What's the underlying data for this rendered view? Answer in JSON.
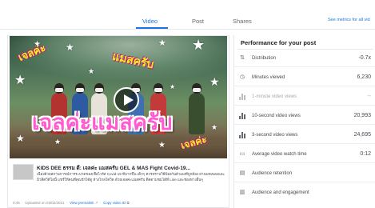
{
  "tabs": [
    {
      "label": "Video",
      "active": true
    },
    {
      "label": "Post",
      "active": false
    },
    {
      "label": "Shares",
      "active": false
    }
  ],
  "see_metrics": "See metrics for all vid",
  "video": {
    "thumbnail_text_main": "เจลค่ะแมสครับ",
    "thumbnail_text_top_left": "เจลค่ะ",
    "thumbnail_text_top_right": "แมสครับ",
    "thumbnail_text_bottom_right": "เจลค่ะ",
    "title": "KIDS DEE ธรรม ดี: เจลค่ะ แมสครับ GEL & MAS Fight Covid-19...",
    "description": "เนื่องด้วยสถานการณ์การระบาดของเชื้อไวรัส Covid-19 ที่มากขึ้น เด็กๆ ควรทราบวิธีป้องกันตัวเองที่ถูกต้อง ผ่านบทเพลงและมิวสิควิดีโอนี้ แชร์ให้คนที่คุณรักได้ดู ห่างไกลโควิด ด้วยเจลค่ะแมสครับ ติดตามชมได้ที่ Line และช่องทางอื่นๆ",
    "duration": "0:45",
    "uploaded": "Uploaded on 03/02/2021",
    "view_permalink": "View permalink",
    "copy_video_id": "Copy video ID"
  },
  "performance": {
    "title": "Performance for your post",
    "metrics": [
      {
        "icon": "distribution-icon",
        "label": "Distribution",
        "value": "-0.7x",
        "faded": false
      },
      {
        "icon": "clock-icon",
        "label": "Minutes viewed",
        "value": "6,230",
        "faded": false
      },
      {
        "icon": "bar-chart-icon",
        "label": "1-minute video views",
        "value": "--",
        "faded": true
      },
      {
        "icon": "bar-chart-icon",
        "label": "10-second video views",
        "value": "20,993",
        "faded": false
      },
      {
        "icon": "bar-chart-icon",
        "label": "3-second video views",
        "value": "24,695",
        "faded": false
      },
      {
        "icon": "video-icon",
        "label": "Average video watch time",
        "value": "0:12",
        "faded": false
      },
      {
        "icon": "retention-icon",
        "label": "Audience retention",
        "value": "",
        "faded": false
      },
      {
        "icon": "audience-icon",
        "label": "Audience and engagement",
        "value": "",
        "faded": false
      }
    ]
  },
  "colors": {
    "accent": "#1b74e4",
    "thumbnail_text": "#ff5bd0",
    "thumbnail_caption": "#f4f020"
  }
}
